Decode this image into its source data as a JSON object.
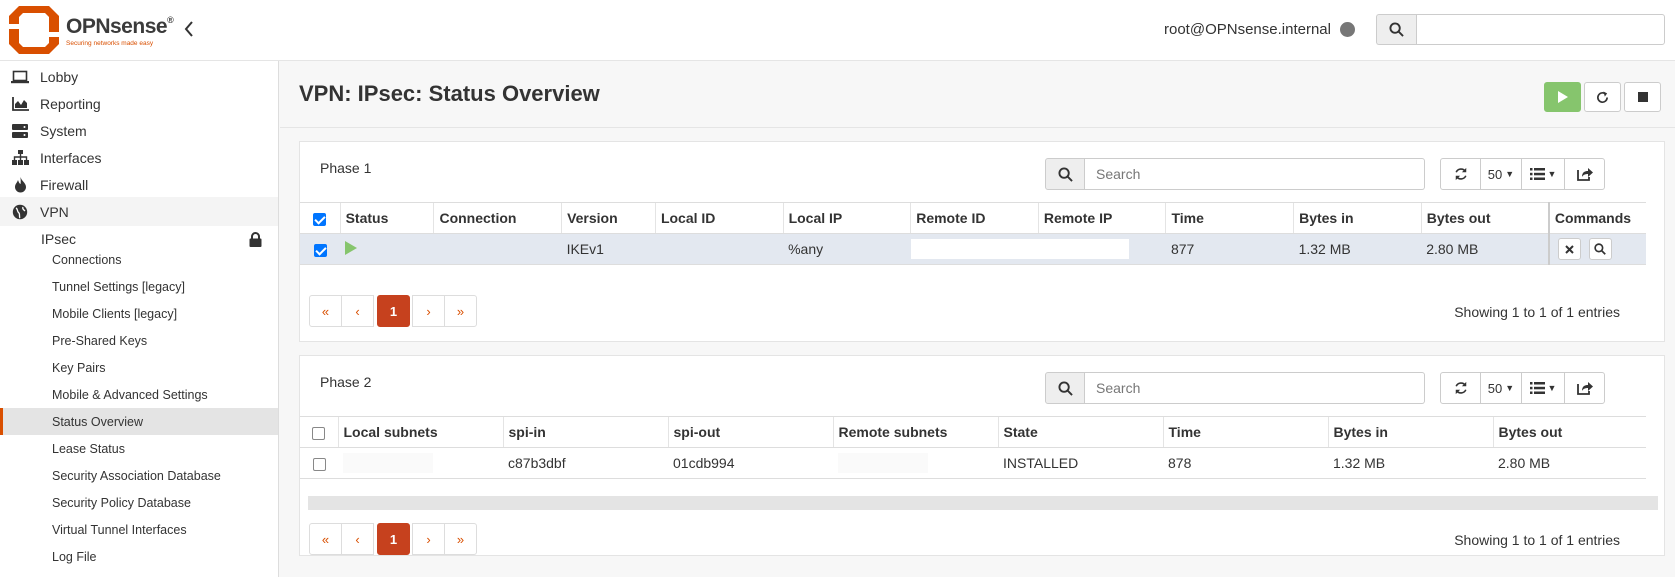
{
  "header": {
    "brand": "OPNsense",
    "reg": "®",
    "tagline": "Securing networks made easy",
    "user": "root@OPNsense.internal",
    "search_placeholder": ""
  },
  "sidebar": {
    "items": [
      {
        "label": "Lobby",
        "icon": "laptop-icon"
      },
      {
        "label": "Reporting",
        "icon": "area-chart-icon"
      },
      {
        "label": "System",
        "icon": "server-icon"
      },
      {
        "label": "Interfaces",
        "icon": "sitemap-icon"
      },
      {
        "label": "Firewall",
        "icon": "fire-icon"
      },
      {
        "label": "VPN",
        "icon": "globe-icon"
      }
    ],
    "ipsec": "IPsec",
    "sub_items": [
      "Connections",
      "Tunnel Settings [legacy]",
      "Mobile Clients [legacy]",
      "Pre-Shared Keys",
      "Key Pairs",
      "Mobile & Advanced Settings",
      "Status Overview",
      "Lease Status",
      "Security Association Database",
      "Security Policy Database",
      "Virtual Tunnel Interfaces",
      "Log File"
    ],
    "active_sub": "Status Overview"
  },
  "page": {
    "title": "VPN: IPsec: Status Overview"
  },
  "phase1": {
    "title": "Phase 1",
    "search_placeholder": "Search",
    "rows_per_page": "50",
    "columns": [
      "Status",
      "Connection",
      "Version",
      "Local ID",
      "Local IP",
      "Remote ID",
      "Remote IP",
      "Time",
      "Bytes in",
      "Bytes out",
      "Commands"
    ],
    "rows": [
      {
        "status": "running",
        "connection": "",
        "version": "IKEv1",
        "local_id": "",
        "local_ip": "%any",
        "remote_id": "",
        "remote_ip": "",
        "time": "877",
        "bytes_in": "1.32 MB",
        "bytes_out": "2.80 MB"
      }
    ],
    "pager": {
      "first": "«",
      "prev": "‹",
      "page": "1",
      "next": "›",
      "last": "»"
    },
    "showing": "Showing 1 to 1 of 1 entries"
  },
  "phase2": {
    "title": "Phase 2",
    "search_placeholder": "Search",
    "rows_per_page": "50",
    "columns": [
      "Local subnets",
      "spi-in",
      "spi-out",
      "Remote subnets",
      "State",
      "Time",
      "Bytes in",
      "Bytes out"
    ],
    "rows": [
      {
        "local_subnets": "",
        "spi_in": "c87b3dbf",
        "spi_out": "01cdb994",
        "remote_subnets": "",
        "state": "INSTALLED",
        "time": "878",
        "bytes_in": "1.32 MB",
        "bytes_out": "2.80 MB"
      }
    ],
    "pager": {
      "first": "«",
      "prev": "‹",
      "page": "1",
      "next": "›",
      "last": "»"
    },
    "showing": "Showing 1 to 1 of 1 entries"
  },
  "colors": {
    "accent": "#d94f00",
    "pager_active": "#c6411e",
    "play_button": "#86c56d",
    "selected_row": "#e3e8f0"
  }
}
